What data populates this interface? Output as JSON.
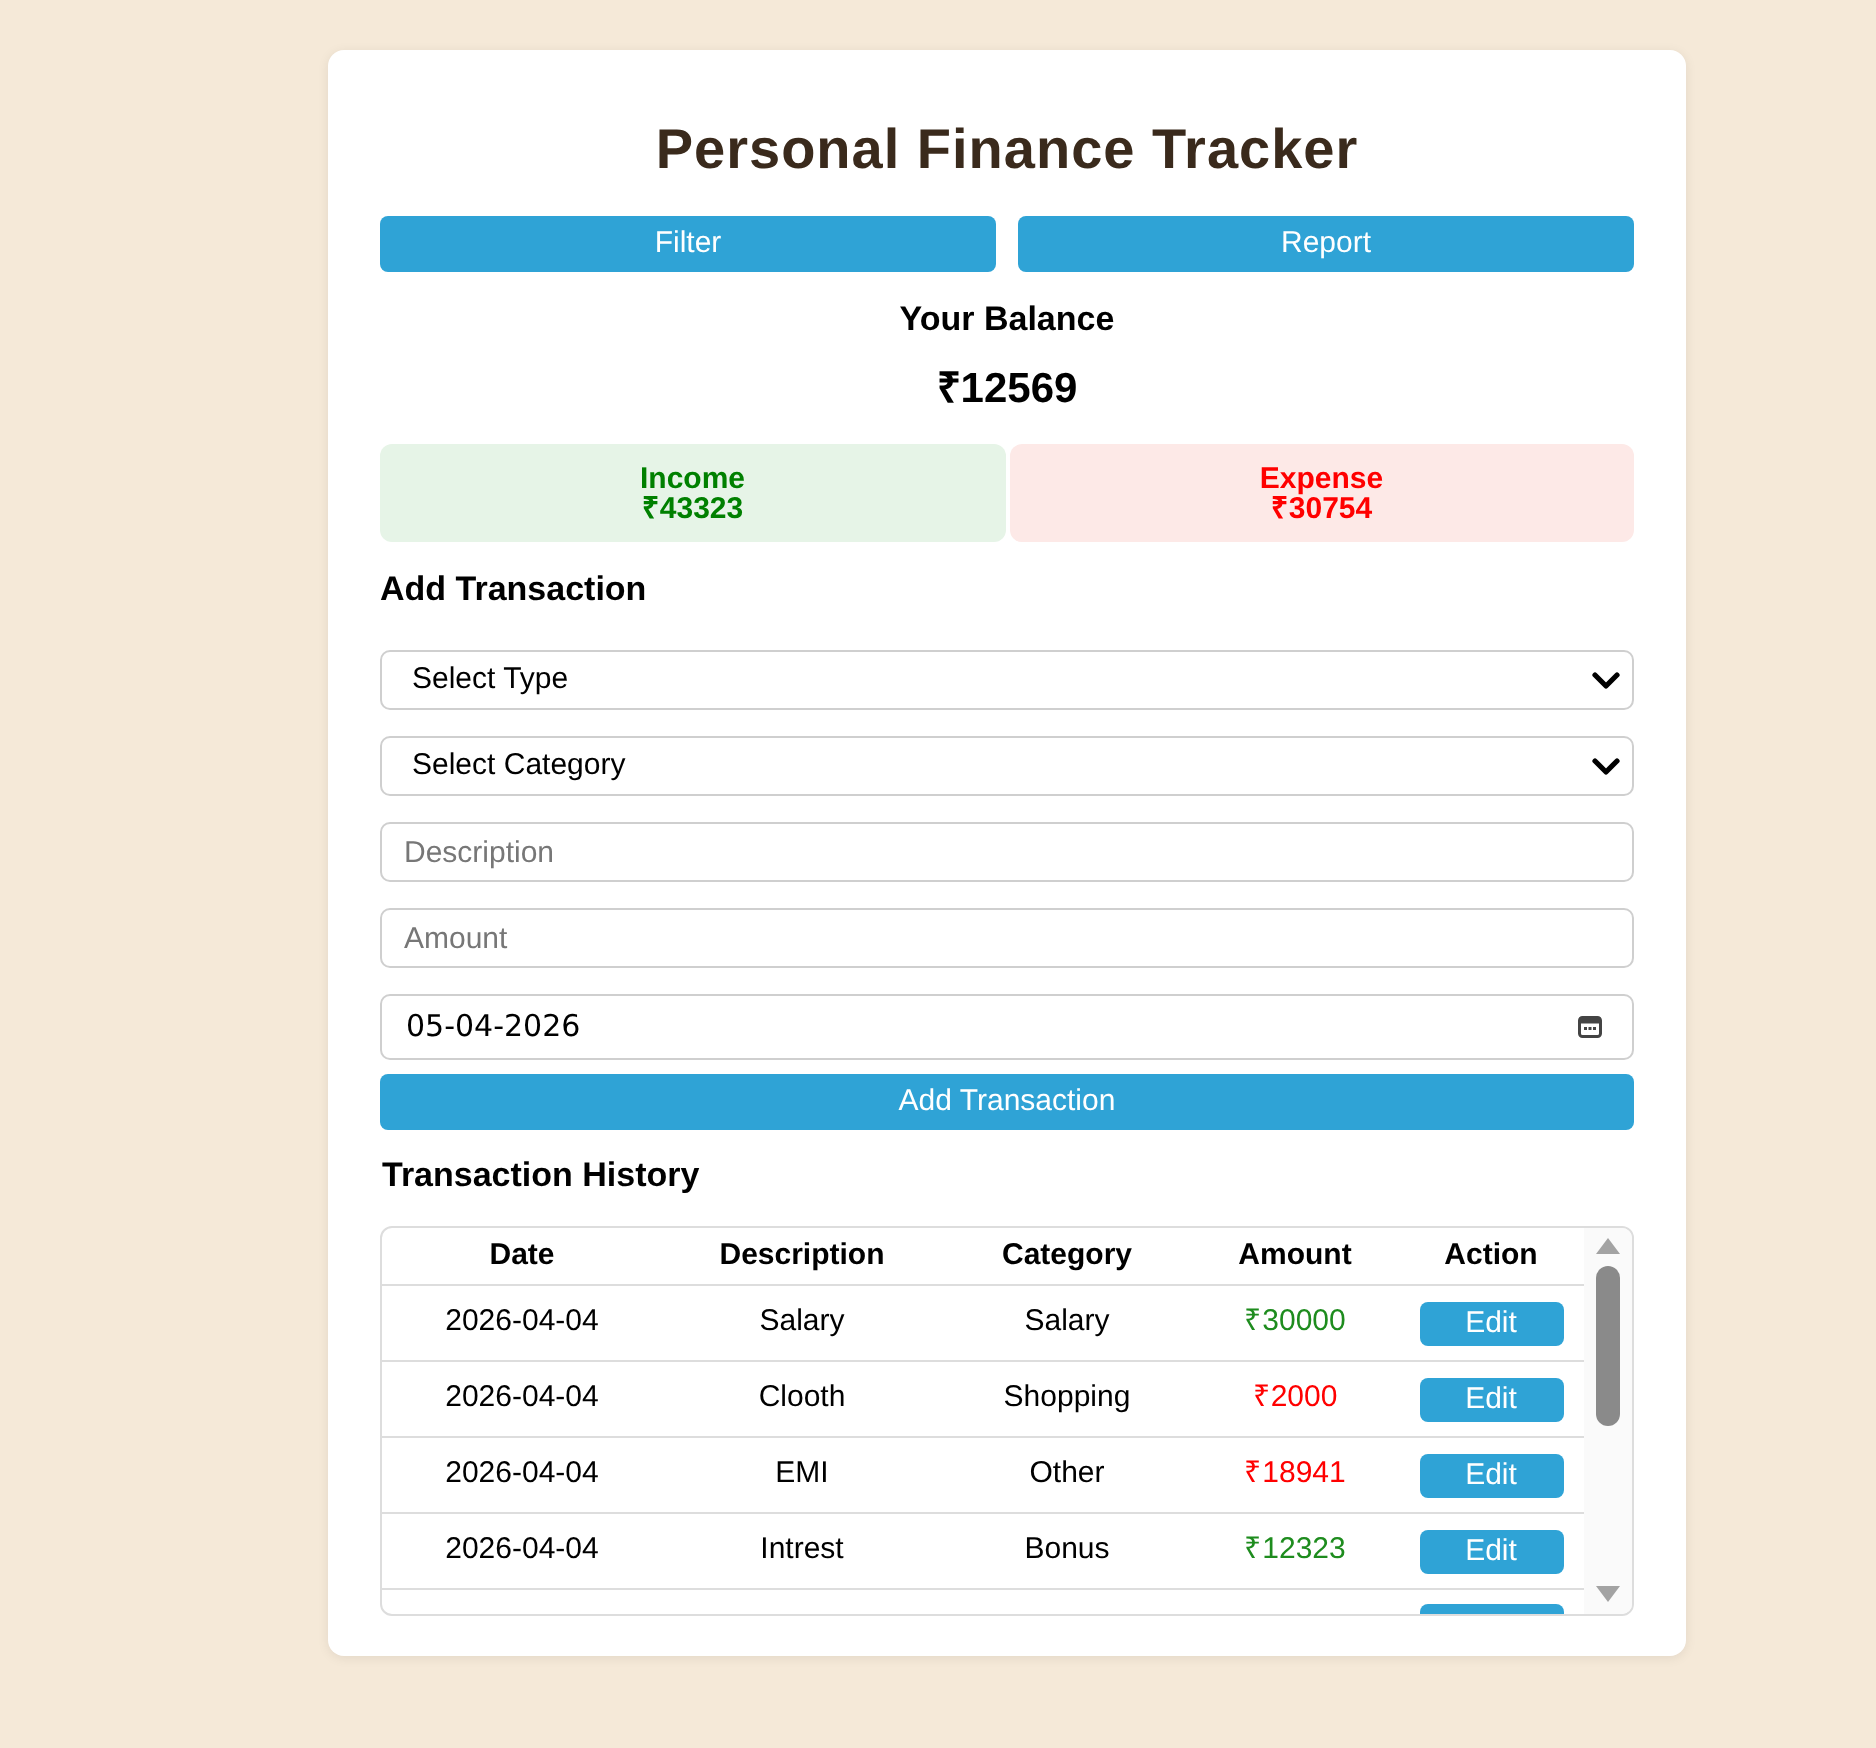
{
  "title": "Personal Finance Tracker",
  "toolbar": [
    {
      "label": "Filter"
    },
    {
      "label": "Report"
    }
  ],
  "balance": {
    "label": "Your Balance",
    "amount": "₹12569"
  },
  "summary": [
    {
      "kind": "income",
      "label": "Income",
      "amount": "₹43323"
    },
    {
      "kind": "expense",
      "label": "Expense",
      "amount": "₹30754"
    }
  ],
  "form": {
    "heading": "Add Transaction",
    "fields": [
      {
        "kind": "select",
        "value": "Select Type"
      },
      {
        "kind": "select",
        "value": "Select Category"
      },
      {
        "kind": "text",
        "placeholder": "Description"
      },
      {
        "kind": "text",
        "placeholder": "Amount"
      },
      {
        "kind": "date",
        "value": "05-04-2026"
      }
    ],
    "submit": "Add Transaction"
  },
  "history": {
    "heading": "Transaction History",
    "columns": [
      "Date",
      "Description",
      "Category",
      "Amount",
      "Action"
    ],
    "rows": [
      {
        "date": "2026-04-04",
        "description": "Salary",
        "category": "Salary",
        "amount": "₹30000",
        "color": "#1e8c1e",
        "action": "Edit"
      },
      {
        "date": "2026-04-04",
        "description": "Clooth",
        "category": "Shopping",
        "amount": "₹2000",
        "color": "#ff0000",
        "action": "Edit"
      },
      {
        "date": "2026-04-04",
        "description": "EMI",
        "category": "Other",
        "amount": "₹18941",
        "color": "#ff0000",
        "action": "Edit"
      },
      {
        "date": "2026-04-04",
        "description": "Intrest",
        "category": "Bonus",
        "amount": "₹12323",
        "color": "#1e8c1e",
        "action": "Edit"
      }
    ],
    "more_rows_below": true
  }
}
